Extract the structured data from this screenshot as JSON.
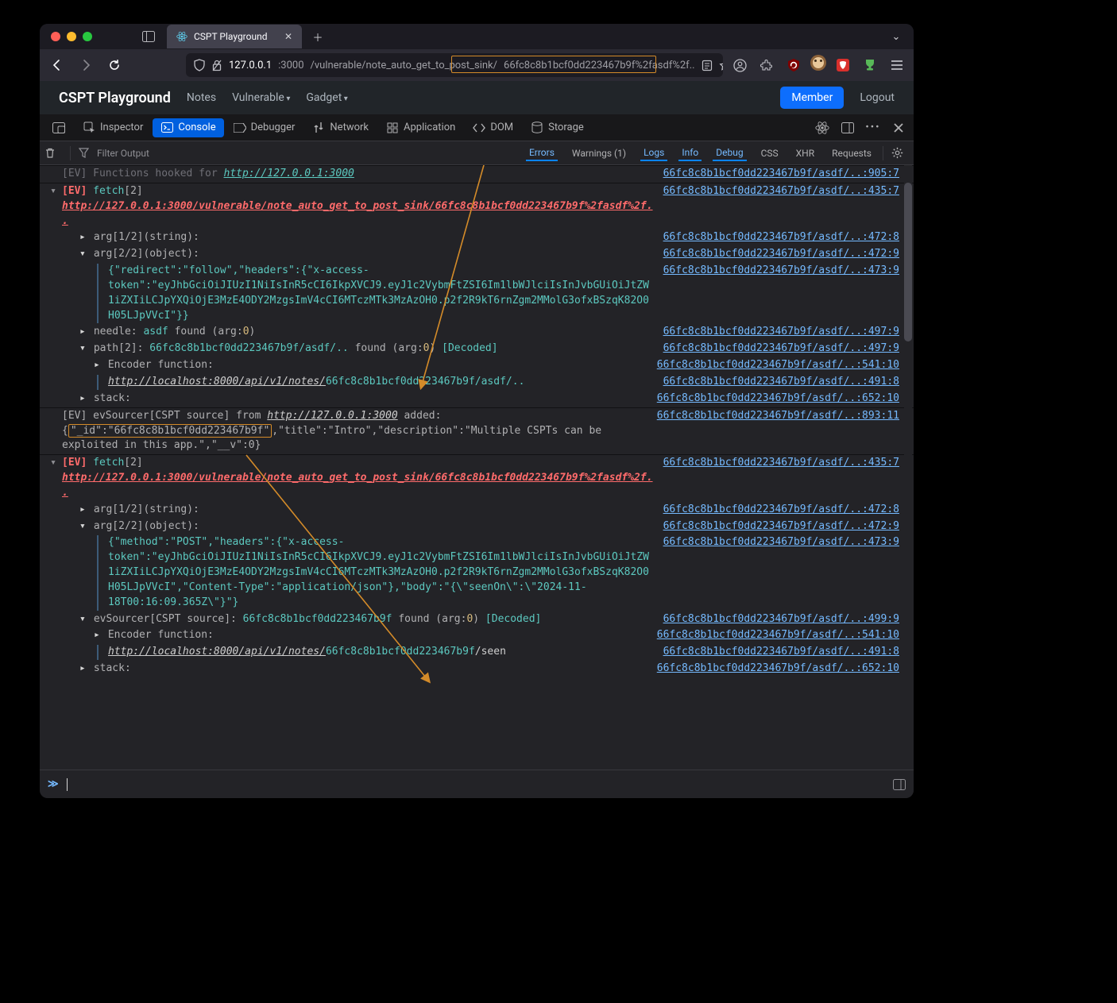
{
  "window": {
    "tab_title": "CSPT Playground"
  },
  "url": {
    "host": "127.0.0.1",
    "port": ":3000",
    "path_prefix": "/vulnerable/note_auto_get_to_post_sink/",
    "path_highlight": "66fc8c8b1bcf0dd223467b9f%2fasdf%2f.."
  },
  "pagenav": {
    "brand": "CSPT Playground",
    "links": [
      "Notes",
      "Vulnerable",
      "Gadget"
    ],
    "member": "Member",
    "logout": "Logout"
  },
  "devtools": {
    "panels": [
      "Inspector",
      "Console",
      "Debugger",
      "Network",
      "Application",
      "DOM",
      "Storage"
    ]
  },
  "filterbar": {
    "placeholder": "Filter Output",
    "chips": {
      "errors": "Errors",
      "warnings": "Warnings (1)",
      "logs": "Logs",
      "info": "Info",
      "debug": "Debug",
      "css": "CSS",
      "xhr": "XHR",
      "requests": "Requests"
    }
  },
  "locs": {
    "top": "66fc8c8b1bcf0dd223467b9f/asdf/..:905:7",
    "fetch": "66fc8c8b1bcf0dd223467b9f/asdf/..:435:7",
    "a472_8": "66fc8c8b1bcf0dd223467b9f/asdf/..:472:8",
    "a472_9": "66fc8c8b1bcf0dd223467b9f/asdf/..:472:9",
    "a473_9": "66fc8c8b1bcf0dd223467b9f/asdf/..:473:9",
    "a497_9": "66fc8c8b1bcf0dd223467b9f/asdf/..:497:9",
    "a499_9": "66fc8c8b1bcf0dd223467b9f/asdf/..:499:9",
    "a541_10": "66fc8c8b1bcf0dd223467b9f/asdf/..:541:10",
    "a491_8": "66fc8c8b1bcf0dd223467b9f/asdf/..:491:8",
    "a652_10": "66fc8c8b1bcf0dd223467b9f/asdf/..:652:10",
    "a893_11": "66fc8c8b1bcf0dd223467b9f/asdf/..:893:11"
  },
  "lines": {
    "hooked": "[EV] Functions hooked for",
    "hooked_url": "http://127.0.0.1:3000",
    "ev": "[EV]",
    "fetch": "fetch",
    "arg_n": "[2]",
    "fetch_url": "http://127.0.0.1:3000/vulnerable/note_auto_get_to_post_sink/66fc8c8b1bcf0dd223467b9f%2fasdf%2f..",
    "arg12": "arg[1/2](string):",
    "arg22": "arg[2/2](object):",
    "hdr1": "{\"redirect\":\"follow\",\"headers\":{\"x-access-token\":\"eyJhbGciOiJIUzI1NiIsInR5cCI6IkpXVCJ9.eyJ1c2VybmFtZSI6Im1lbWJlciIsInJvbGUiOiJtZW1iZXIiLCJpYXQiOjE3MzE4ODY2MzgsImV4cCI6MTczMTk3MzAzOH0.p2f2R9kT6rnZgm2MMolG3ofxBSzqK82O0H05LJpVVcI\"}}",
    "needle_lbl": "needle:",
    "needle_val": "asdf",
    "needle_rest": "found (arg:",
    "arg0": "0",
    "close_paren": ")",
    "path_lbl": "path[2]:",
    "path_val": "66fc8c8b1bcf0dd223467b9f/asdf/..",
    "decoded": "[Decoded]",
    "enc_fn": "Encoder function:",
    "api_prefix": "http://localhost:8000/api/v1/notes/",
    "api_suffix1": "66fc8c8b1bcf0dd223467b9f/asdf/..",
    "stack": "stack:",
    "ev_src_pre": "[EV] evSourcer[CSPT source] from",
    "ev_src_url": "http://127.0.0.1:3000",
    "ev_src_post": " added:",
    "json_id_open": "{",
    "json_id_key": "\"_id\":\"66fc8c8b1bcf0dd223467b9f\"",
    "json_rest": ",\"title\":\"Intro\",\"description\":\"Multiple CSPTs can be exploited in this app.\",\"__v\":0}",
    "hdr2": "{\"method\":\"POST\",\"headers\":{\"x-access-token\":\"eyJhbGciOiJIUzI1NiIsInR5cCI6IkpXVCJ9.eyJ1c2VybmFtZSI6Im1lbWJlciIsInJvbGUiOiJtZW1iZXIiLCJpYXQiOjE3MzE4ODY2MzgsImV4cCI6MTczMTk3MzAzOH0.p2f2R9kT6rnZgm2MMolG3ofxBSzqK82O0H05LJpVVcI\",\"Content-Type\":\"application/json\"},\"body\":\"{\\\"seenOn\\\":\\\"2024-11-18T00:16:09.365Z\\\"}\"}",
    "src_lbl": "evSourcer[CSPT source]:",
    "src_val": "66fc8c8b1bcf0dd223467b9f",
    "api_suffix2_a": "66fc8c8b1bcf0dd223467b9f",
    "api_suffix2_b": "/seen"
  }
}
